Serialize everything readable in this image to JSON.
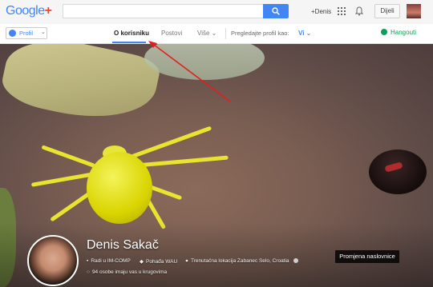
{
  "logo": {
    "google": "Google",
    "plus": "+"
  },
  "search": {
    "placeholder": ""
  },
  "header": {
    "user_link": "+Denis",
    "share_label": "Dijeli"
  },
  "nav": {
    "profile_label": "Profil",
    "tabs": [
      {
        "label": "O korisniku",
        "active": true
      },
      {
        "label": "Postovi",
        "active": false
      },
      {
        "label": "Više",
        "active": false
      }
    ],
    "view_as_label": "Pregledajte profil kao:",
    "view_as_value": "Vi",
    "hangouts_label": "Hangouti"
  },
  "profile": {
    "name": "Denis Sakač",
    "work": "Radi u IM-COMP",
    "education": "Pohađa WAU",
    "location": "Trenutačna lokacija Zabanec Selo, Croatia",
    "circles": "94 osobe imaju vas u krugovima",
    "cover_button": "Promjena naslovnice"
  },
  "colors": {
    "accent": "#4285f4",
    "hangouts": "#0f9d58",
    "annotation_arrow": "#e02020"
  }
}
